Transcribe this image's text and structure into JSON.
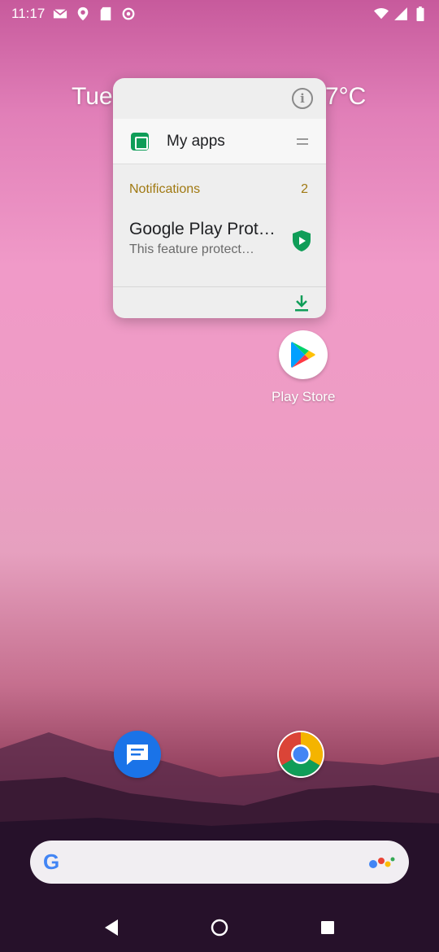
{
  "status_bar": {
    "time": "11:17",
    "left_icons": [
      "gmail-icon",
      "location-icon",
      "sd-card-icon",
      "sync-icon"
    ],
    "right_icons": [
      "wifi-icon",
      "signal-icon",
      "battery-icon"
    ]
  },
  "home": {
    "date_text": "Tue",
    "temp_text": "7°C"
  },
  "popup": {
    "shortcut_label": "My apps",
    "notifications_label": "Notifications",
    "notifications_count": "2",
    "notification_title": "Google Play Prot…",
    "notification_text": "This feature protect…"
  },
  "apps": {
    "play_store_label": "Play Store"
  },
  "dock": {
    "messages": "messages-icon",
    "chrome": "chrome-icon"
  },
  "search": {
    "logo": "G"
  },
  "colors": {
    "accent_gold": "#a07912",
    "play_green": "#0f9d58"
  }
}
